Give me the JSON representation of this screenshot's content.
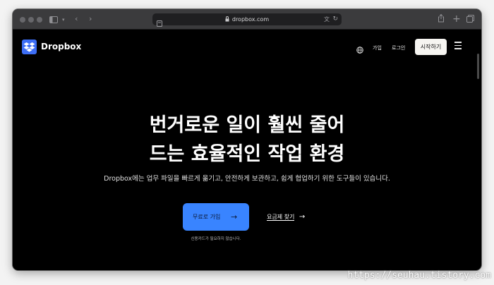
{
  "browser": {
    "url": "dropbox.com",
    "icons": [
      "sidebar-icon",
      "chevron-down-icon",
      "back-icon",
      "forward-icon",
      "page-icon",
      "lock-icon",
      "translate-icon",
      "reload-icon",
      "share-icon",
      "new-tab-icon",
      "tabs-overview-icon"
    ]
  },
  "header": {
    "brand": "Dropbox",
    "nav": {
      "language_icon": "globe-icon",
      "signup": "가입",
      "login": "로그인",
      "start": "시작하기",
      "menu_icon": "hamburger-menu-icon"
    }
  },
  "hero": {
    "headline_line1": "번거로운 일이 훨씬 줄어",
    "headline_line2": "드는 효율적인 작업 환경",
    "subtext": "Dropbox에는 업무 파일을 빠르게 옮기고, 안전하게 보관하고, 쉽게 협업하기 위한 도구들이 있습니다.",
    "cta_label": "무료로 가입",
    "pricing_label": "요금제 찾기",
    "note": "신용카드가 필요하지 않습니다."
  },
  "watermark": "https://seuhau.tistory.com",
  "colors": {
    "accent": "#3984ff",
    "logo": "#3d6ef5",
    "background": "#000000"
  }
}
